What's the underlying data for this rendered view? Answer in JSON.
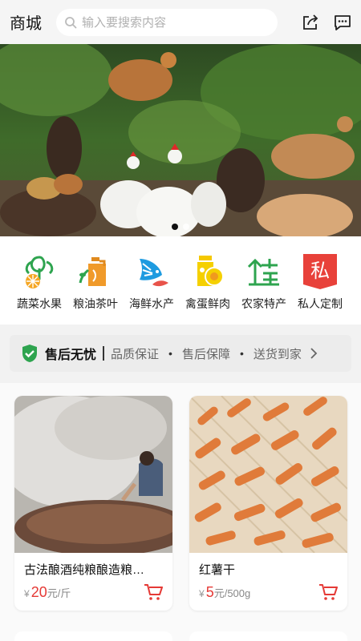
{
  "header": {
    "title": "商城",
    "search_placeholder": "输入要搜索内容"
  },
  "banner": {
    "slides": 2,
    "active_index": 0
  },
  "categories": [
    {
      "label": "蔬菜水果",
      "icon": "vegetables-fruit-icon"
    },
    {
      "label": "粮油茶叶",
      "icon": "grain-oil-tea-icon"
    },
    {
      "label": "海鲜水产",
      "icon": "seafood-icon"
    },
    {
      "label": "禽蛋鲜肉",
      "icon": "eggs-meat-icon"
    },
    {
      "label": "农家特产",
      "icon": "farm-specialty-icon"
    },
    {
      "label": "私人定制",
      "icon": "custom-icon",
      "glyph": "私"
    }
  ],
  "assurance": {
    "title": "售后无忧",
    "items": [
      "品质保证",
      "售后保障",
      "送货到家"
    ]
  },
  "products": [
    {
      "name": "古法酿酒纯粮酿造粮…",
      "currency": "¥",
      "price": "20",
      "unit": "元/斤"
    },
    {
      "name": "红薯干",
      "currency": "¥",
      "price": "5",
      "unit": "元/500g"
    }
  ],
  "colors": {
    "accent_red": "#e53935",
    "shield_green": "#2ea44f"
  }
}
